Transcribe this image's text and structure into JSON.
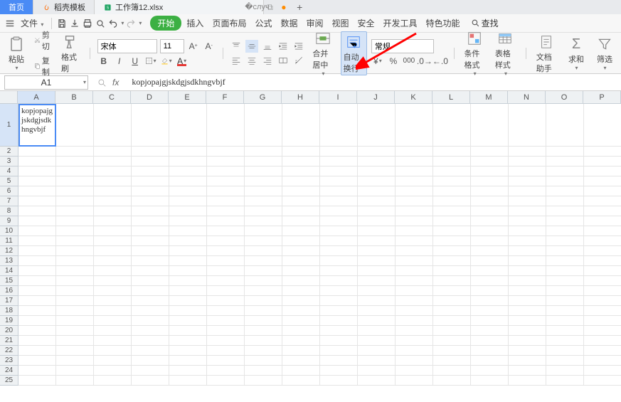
{
  "tabs": [
    {
      "label": "首页",
      "icon": "",
      "active": true
    },
    {
      "label": "稻壳模板",
      "icon": "flame"
    },
    {
      "label": "工作簿12.xlsx",
      "icon": "sheet",
      "closable": true,
      "dirty": true
    }
  ],
  "menubar": {
    "file": "文件",
    "items": [
      "开始",
      "插入",
      "页面布局",
      "公式",
      "数据",
      "审阅",
      "视图",
      "安全",
      "开发工具",
      "特色功能"
    ],
    "active": "开始",
    "search": "查找"
  },
  "ribbon": {
    "clipboard": {
      "paste": "粘贴",
      "cut": "剪切",
      "copy": "复制",
      "format_painter": "格式刷"
    },
    "font": {
      "name": "宋体",
      "size": "11"
    },
    "merge": "合并居中",
    "wrap": "自动换行",
    "number_format": "常规",
    "cond_format": "条件格式",
    "table_style": "表格样式",
    "doc_helper": "文档助手",
    "sum": "求和",
    "filter": "筛选"
  },
  "namebox": "A1",
  "formula": "kopjopajgjskdgjsdkhngvbjf",
  "columns": [
    "A",
    "B",
    "C",
    "D",
    "E",
    "F",
    "G",
    "H",
    "I",
    "J",
    "K",
    "L",
    "M",
    "N",
    "O",
    "P"
  ],
  "rows_first": 1,
  "rows_last": 25,
  "active_cell": {
    "row": 1,
    "col": "A",
    "value": "kopjopajgjskdgjsdkhngvbjf"
  },
  "colors": {
    "accent": "#4a8bf5",
    "pill": "#3cb043",
    "arrow": "#ff0000"
  }
}
